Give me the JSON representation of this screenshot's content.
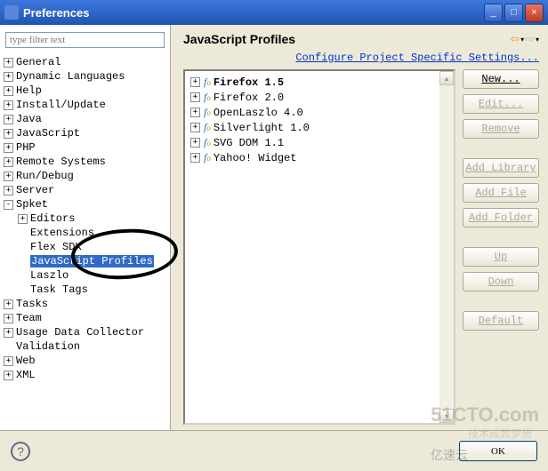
{
  "window": {
    "title": "Preferences"
  },
  "filter": {
    "placeholder": "type filter text"
  },
  "tree": {
    "items": [
      {
        "label": "General",
        "toggle": "+"
      },
      {
        "label": "Dynamic Languages",
        "toggle": "+"
      },
      {
        "label": "Help",
        "toggle": "+"
      },
      {
        "label": "Install/Update",
        "toggle": "+"
      },
      {
        "label": "Java",
        "toggle": "+"
      },
      {
        "label": "JavaScript",
        "toggle": "+"
      },
      {
        "label": "PHP",
        "toggle": "+"
      },
      {
        "label": "Remote Systems",
        "toggle": "+"
      },
      {
        "label": "Run/Debug",
        "toggle": "+"
      },
      {
        "label": "Server",
        "toggle": "+"
      },
      {
        "label": "Spket",
        "toggle": "-"
      },
      {
        "label": "Tasks",
        "toggle": "+"
      },
      {
        "label": "Team",
        "toggle": "+"
      },
      {
        "label": "Usage Data Collector",
        "toggle": "+"
      },
      {
        "label": "Validation",
        "toggle": ""
      },
      {
        "label": "Web",
        "toggle": "+"
      },
      {
        "label": "XML",
        "toggle": "+"
      }
    ],
    "spket_children": [
      {
        "label": "Editors",
        "toggle": "+"
      },
      {
        "label": "Extensions",
        "toggle": ""
      },
      {
        "label": "Flex SDK",
        "toggle": ""
      },
      {
        "label": "JavaScript Profiles",
        "toggle": "",
        "selected": true
      },
      {
        "label": "Laszlo",
        "toggle": ""
      },
      {
        "label": "Task Tags",
        "toggle": ""
      }
    ]
  },
  "page": {
    "title": "JavaScript Profiles",
    "config_link": "Configure Project Specific Settings..."
  },
  "profiles": [
    {
      "label": "Firefox 1.5",
      "default": true
    },
    {
      "label": "Firefox 2.0",
      "default": false
    },
    {
      "label": "OpenLaszlo 4.0",
      "default": false
    },
    {
      "label": "Silverlight 1.0",
      "default": false
    },
    {
      "label": "SVG DOM 1.1",
      "default": false
    },
    {
      "label": "Yahoo! Widget",
      "default": false
    }
  ],
  "buttons": {
    "new": "New...",
    "edit": "Edit...",
    "remove": "Remove",
    "add_library": "Add Library",
    "add_file": "Add File",
    "add_folder": "Add Folder",
    "up": "Up",
    "down": "Down",
    "default": "Default",
    "ok": "OK"
  },
  "watermark": {
    "main": "51CTO.com",
    "sub": "技术成就梦想",
    "cn": "亿速云"
  }
}
